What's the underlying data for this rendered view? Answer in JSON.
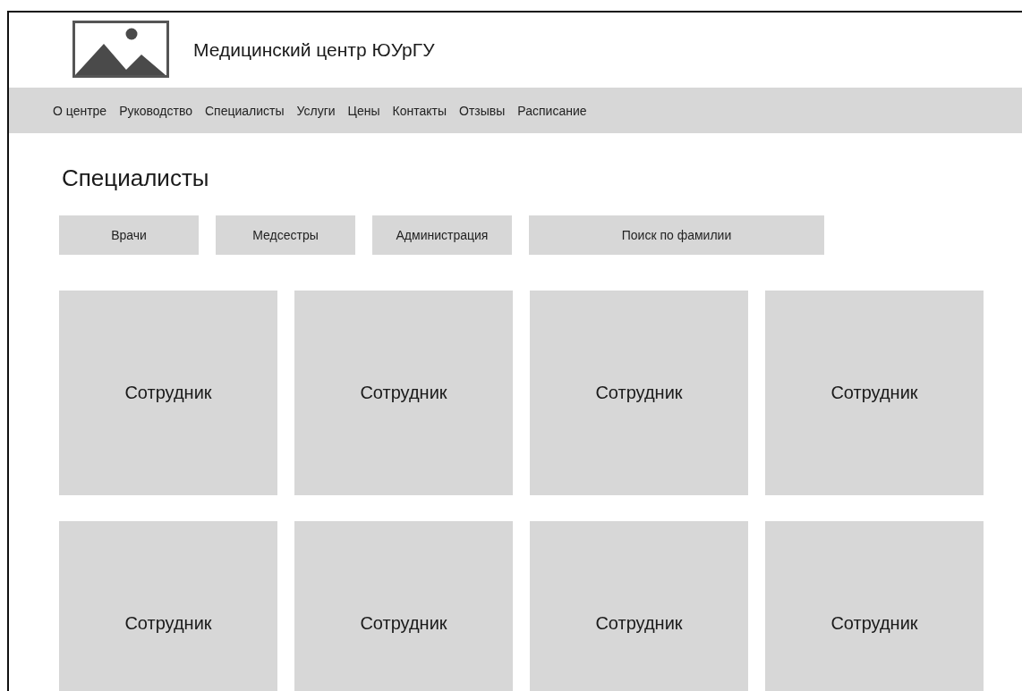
{
  "header": {
    "title": "Медицинский центр ЮУрГУ"
  },
  "nav": [
    "О центре",
    "Руководство",
    "Специалисты",
    "Услуги",
    "Цены",
    "Контакты",
    "Отзывы",
    "Расписание"
  ],
  "page_title": "Специалисты",
  "filters": [
    {
      "kind": "button",
      "label": "Врачи"
    },
    {
      "kind": "button",
      "label": "Медсестры"
    },
    {
      "kind": "button",
      "label": "Администрация"
    },
    {
      "kind": "search",
      "placeholder": "Поиск по фамилии"
    }
  ],
  "staff": [
    "Сотрудник",
    "Сотрудник",
    "Сотрудник",
    "Сотрудник",
    "Сотрудник",
    "Сотрудник",
    "Сотрудник",
    "Сотрудник"
  ]
}
